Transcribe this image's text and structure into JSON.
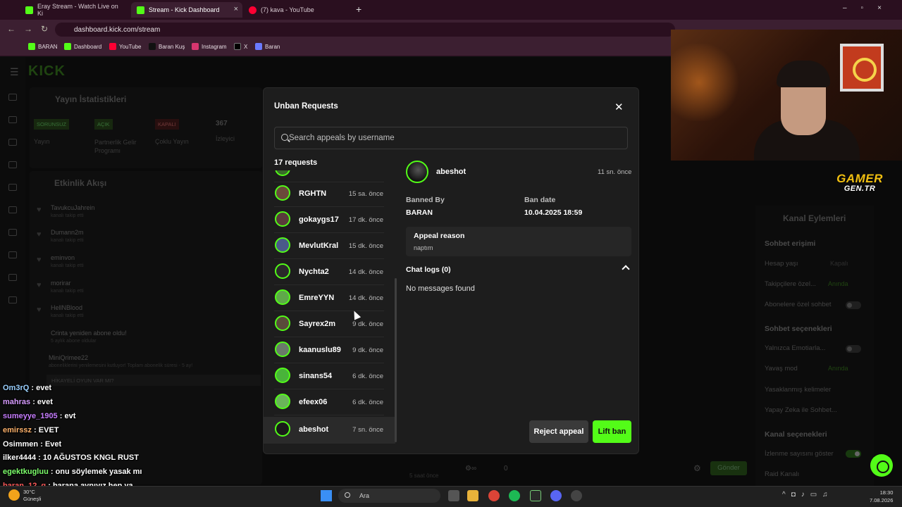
{
  "browser": {
    "tabs": [
      {
        "title": "Eray Stream - Watch Live on Ki",
        "favicon_color": "#53fc18"
      },
      {
        "title": "Stream - Kick Dashboard",
        "favicon_color": "#53fc18"
      },
      {
        "title": "(7) kava - YouTube",
        "favicon_color": "#ff0033"
      }
    ],
    "url": "dashboard.kick.com/stream",
    "bookmarks": [
      "BARAN",
      "Dashboard",
      "YouTube",
      "Baran Kuş",
      "Instagram",
      "X",
      "Baran"
    ]
  },
  "background": {
    "logo": "KICK",
    "stats_title": "Yayın İstatistikleri",
    "stats": [
      {
        "badge": "SORUNSUZ",
        "label": "Yayın"
      },
      {
        "badge": "AÇIK",
        "label": "Partnerlik Gelir Programı"
      },
      {
        "badge": "KAPALI",
        "label": "Çoklu Yayın"
      },
      {
        "badge": "367",
        "label": "İzleyici"
      }
    ],
    "activity_title": "Etkinlik Akışı",
    "activity": [
      {
        "name": "TavukcuJahrein",
        "sub": "kanalı takip etti"
      },
      {
        "name": "Dumann2m",
        "sub": "kanalı takip etti"
      },
      {
        "name": "eminvon",
        "sub": "kanalı takip etti"
      },
      {
        "name": "morirar",
        "sub": "kanalı takip etti"
      },
      {
        "name": "HellNBlood",
        "sub": "kanalı takip etti"
      },
      {
        "name": "Crinta yeniden abone oldu!",
        "sub": "5 aylık abone oldular"
      },
      {
        "name": "MiniQrimee22",
        "sub": "aboneliklerini yenilemesini kutluyor! Toplam abonelik süresi - 5 ay!"
      }
    ],
    "highlight": "HİKAYELİ OYUN VAR MI?",
    "bottom_time": "5 saat önce",
    "send_label": "Gönder",
    "viewers_zero": "0",
    "right_panel": {
      "title": "Kanal Eylemleri",
      "sections": [
        {
          "heading": "Sohbet erişimi"
        },
        {
          "heading": "Sohbet seçenekleri"
        },
        {
          "heading": "Kanal seçenekleri"
        }
      ],
      "rows": [
        {
          "label": "Hesap yaşı",
          "value": "Kapalı"
        },
        {
          "label": "Takipçilere özel...",
          "value": "Anında"
        },
        {
          "label": "Abonelere özel sohbet",
          "value": ""
        },
        {
          "label": "Yalnızca Emotiarla...",
          "value": ""
        },
        {
          "label": "Yavaş mod",
          "value": "Anında"
        },
        {
          "label": "Yasaklanmış kelimeler",
          "value": ""
        },
        {
          "label": "Yapay Zeka ile Sohbet...",
          "value": ""
        },
        {
          "label": "İzlenme sayısını göster",
          "value": ""
        },
        {
          "label": "Raid Kanalı",
          "value": ""
        }
      ]
    }
  },
  "overlay": {
    "brand_top": "GAMER",
    "brand_bottom": "GEN.TR"
  },
  "modal": {
    "title": "Unban Requests",
    "search_placeholder": "Search appeals by username",
    "count_label": "17 requests",
    "requests": [
      {
        "username": "RGHTN",
        "time": "15 sa. önce",
        "avatar_color": "#6b4a3a"
      },
      {
        "username": "gokaygs17",
        "time": "17 dk. önce",
        "avatar_color": "#5a3b3b"
      },
      {
        "username": "MevlutKral",
        "time": "15 dk. önce",
        "avatar_color": "#4a5a8a"
      },
      {
        "username": "Nychta2",
        "time": "14 dk. önce",
        "avatar_color": "#2a2a2a"
      },
      {
        "username": "EmreYYN",
        "time": "14 dk. önce",
        "avatar_color": "#5fa84a"
      },
      {
        "username": "Sayrex2m",
        "time": "9 dk. önce",
        "avatar_color": "#5a4a3a"
      },
      {
        "username": "kaanuslu89",
        "time": "9 dk. önce",
        "avatar_color": "#6a7a6a"
      },
      {
        "username": "sinans54",
        "time": "6 dk. önce",
        "avatar_color": "#49b43a"
      },
      {
        "username": "efeex06",
        "time": "6 dk. önce",
        "avatar_color": "#6ab45a"
      },
      {
        "username": "abeshot",
        "time": "7 sn. önce",
        "avatar_color": "#1a1a1a"
      }
    ],
    "selected": {
      "username": "abeshot",
      "time": "11 sn. önce",
      "banned_by_label": "Banned By",
      "banned_by": "BARAN",
      "ban_date_label": "Ban date",
      "ban_date": "10.04.2025 18:59",
      "reason_label": "Appeal reason",
      "reason": "naptım",
      "chat_logs_label": "Chat logs (0)",
      "no_messages": "No messages found"
    },
    "reject_label": "Reject appeal",
    "lift_label": "Lift ban"
  },
  "chat_overlay": [
    {
      "user": "Om3rQ",
      "msg": "evet",
      "color": "#9ad0ff"
    },
    {
      "user": "mahras",
      "msg": "evet",
      "color": "#d79bff"
    },
    {
      "user": "sumeyye_1905",
      "msg": "evt",
      "color": "#c77dff"
    },
    {
      "user": "emirssz",
      "msg": "EVET",
      "color": "#ffb26b"
    },
    {
      "user": "Osimmen",
      "msg": "Evet",
      "color": "#ffffff"
    },
    {
      "user": "ilker4444",
      "msg": "10 AĞUSTOS KNGL RUST",
      "color": "#ffffff"
    },
    {
      "user": "egektkugluu",
      "msg": "onu söylemek yasak mı",
      "color": "#7dff6b"
    },
    {
      "user": "baran_12_g",
      "msg": "barana aynıyız hep ya",
      "color": "#ff5a5a"
    }
  ],
  "taskbar": {
    "weather_temp": "30°C",
    "weather_desc": "Güneşli",
    "search_label": "Ara",
    "time": "18:30",
    "date": "7.08.2026"
  }
}
